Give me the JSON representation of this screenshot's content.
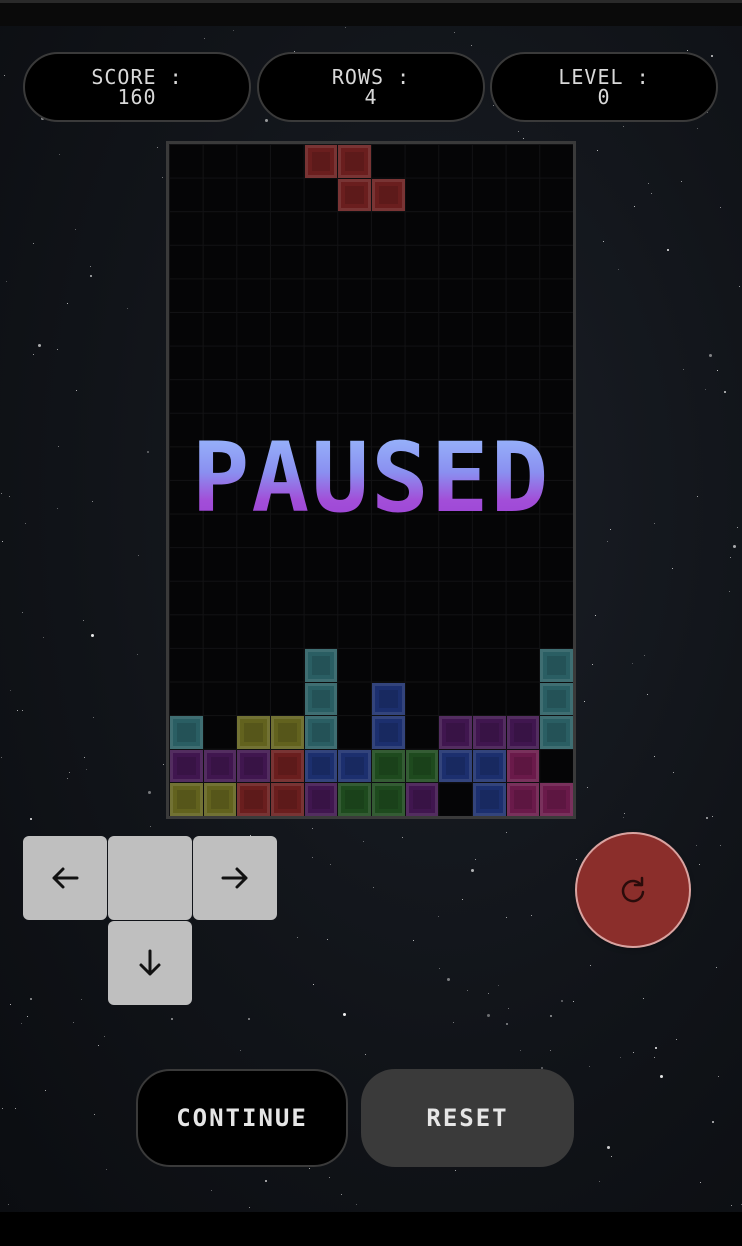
{
  "stats": {
    "score": {
      "label": "SCORE :",
      "value": "160"
    },
    "rows": {
      "label": "ROWS :",
      "value": "4"
    },
    "level": {
      "label": "LEVEL :",
      "value": "0"
    }
  },
  "overlay": {
    "paused_text": "PAUSED"
  },
  "controls": {
    "left_icon": "arrow-left-icon",
    "right_icon": "arrow-right-icon",
    "down_icon": "arrow-down-icon",
    "rotate_icon": "rotate-icon"
  },
  "buttons": {
    "continue": "CONTINUE",
    "reset": "RESET"
  },
  "colors": {
    "red": "#6a1e1e",
    "teal": "#2a5e63",
    "yellow": "#62621e",
    "blue": "#1c2f6e",
    "purple": "#40164f",
    "green": "#1e4a1e",
    "magenta": "#6a1a4a",
    "rotate_button": "#8b2e2b"
  },
  "board": {
    "cols": 12,
    "rows": 20,
    "active_piece": [
      [
        4,
        0,
        "red"
      ],
      [
        5,
        0,
        "red"
      ],
      [
        5,
        1,
        "red"
      ],
      [
        6,
        1,
        "red"
      ]
    ],
    "cells": [
      [
        4,
        15,
        "teal"
      ],
      [
        11,
        15,
        "teal"
      ],
      [
        4,
        16,
        "teal"
      ],
      [
        6,
        16,
        "blue"
      ],
      [
        11,
        16,
        "teal"
      ],
      [
        0,
        17,
        "teal"
      ],
      [
        2,
        17,
        "yellow"
      ],
      [
        3,
        17,
        "yellow"
      ],
      [
        4,
        17,
        "teal"
      ],
      [
        6,
        17,
        "blue"
      ],
      [
        8,
        17,
        "purple"
      ],
      [
        9,
        17,
        "purple"
      ],
      [
        10,
        17,
        "purple"
      ],
      [
        11,
        17,
        "teal"
      ],
      [
        0,
        18,
        "purple"
      ],
      [
        1,
        18,
        "purple"
      ],
      [
        2,
        18,
        "purple"
      ],
      [
        3,
        18,
        "red"
      ],
      [
        4,
        18,
        "blue"
      ],
      [
        5,
        18,
        "blue"
      ],
      [
        6,
        18,
        "green"
      ],
      [
        7,
        18,
        "green"
      ],
      [
        8,
        18,
        "blue"
      ],
      [
        9,
        18,
        "blue"
      ],
      [
        10,
        18,
        "magenta"
      ],
      [
        0,
        19,
        "yellow"
      ],
      [
        1,
        19,
        "yellow"
      ],
      [
        2,
        19,
        "red"
      ],
      [
        3,
        19,
        "red"
      ],
      [
        4,
        19,
        "purple"
      ],
      [
        5,
        19,
        "green"
      ],
      [
        6,
        19,
        "green"
      ],
      [
        7,
        19,
        "purple"
      ],
      [
        9,
        19,
        "blue"
      ],
      [
        10,
        19,
        "magenta"
      ],
      [
        11,
        19,
        "magenta"
      ]
    ]
  }
}
